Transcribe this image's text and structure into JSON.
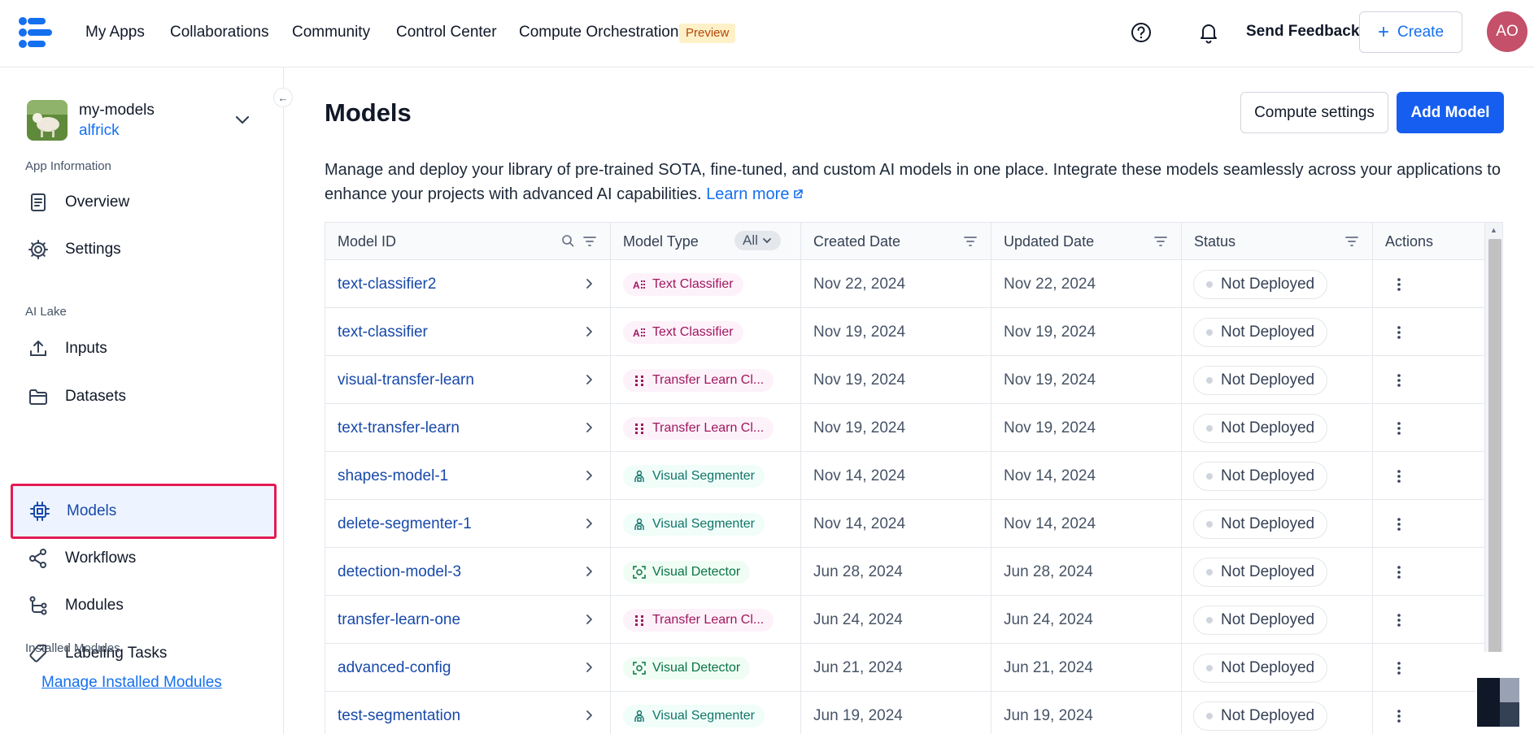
{
  "topnav": {
    "items": [
      "My Apps",
      "Collaborations",
      "Community",
      "Control Center",
      "Compute Orchestration"
    ],
    "preview_badge": "Preview",
    "send_feedback": "Send Feedback",
    "create_label": "Create",
    "avatar_initials": "AO"
  },
  "sidebar": {
    "app_name": "my-models",
    "app_user": "alfrick",
    "section_app_info": "App Information",
    "overview": "Overview",
    "settings": "Settings",
    "section_ai_lake": "AI Lake",
    "inputs": "Inputs",
    "datasets": "Datasets",
    "models": "Models",
    "workflows": "Workflows",
    "modules": "Modules",
    "labeling_tasks": "Labeling Tasks",
    "section_installed": "Installed Modules",
    "manage_installed": "Manage Installed Modules"
  },
  "main": {
    "title": "Models",
    "compute_settings": "Compute settings",
    "add_model": "Add Model",
    "description": "Manage and deploy your library of pre-trained SOTA, fine-tuned, and custom AI models in one place. Integrate these models seamlessly across your applications to enhance your projects with advanced AI capabilities.",
    "learn_more": "Learn more"
  },
  "table": {
    "headers": {
      "model_id": "Model ID",
      "model_type": "Model Type",
      "type_filter": "All",
      "created": "Created Date",
      "updated": "Updated Date",
      "status": "Status",
      "actions": "Actions"
    },
    "rows": [
      {
        "id": "text-classifier2",
        "type": "Text Classifier",
        "kind": "text",
        "created": "Nov 22, 2024",
        "updated": "Nov 22, 2024",
        "status": "Not Deployed"
      },
      {
        "id": "text-classifier",
        "type": "Text Classifier",
        "kind": "text",
        "created": "Nov 19, 2024",
        "updated": "Nov 19, 2024",
        "status": "Not Deployed"
      },
      {
        "id": "visual-transfer-learn",
        "type": "Transfer Learn Cl...",
        "kind": "transfer",
        "created": "Nov 19, 2024",
        "updated": "Nov 19, 2024",
        "status": "Not Deployed"
      },
      {
        "id": "text-transfer-learn",
        "type": "Transfer Learn Cl...",
        "kind": "transfer",
        "created": "Nov 19, 2024",
        "updated": "Nov 19, 2024",
        "status": "Not Deployed"
      },
      {
        "id": "shapes-model-1",
        "type": "Visual Segmenter",
        "kind": "segmenter",
        "created": "Nov 14, 2024",
        "updated": "Nov 14, 2024",
        "status": "Not Deployed"
      },
      {
        "id": "delete-segmenter-1",
        "type": "Visual Segmenter",
        "kind": "segmenter",
        "created": "Nov 14, 2024",
        "updated": "Nov 14, 2024",
        "status": "Not Deployed"
      },
      {
        "id": "detection-model-3",
        "type": "Visual Detector",
        "kind": "detector",
        "created": "Jun 28, 2024",
        "updated": "Jun 28, 2024",
        "status": "Not Deployed"
      },
      {
        "id": "transfer-learn-one",
        "type": "Transfer Learn Cl...",
        "kind": "transfer",
        "created": "Jun 24, 2024",
        "updated": "Jun 24, 2024",
        "status": "Not Deployed"
      },
      {
        "id": "advanced-config",
        "type": "Visual Detector",
        "kind": "detector",
        "created": "Jun 21, 2024",
        "updated": "Jun 21, 2024",
        "status": "Not Deployed"
      },
      {
        "id": "test-segmentation",
        "type": "Visual Segmenter",
        "kind": "segmenter",
        "created": "Jun 19, 2024",
        "updated": "Jun 19, 2024",
        "status": "Not Deployed"
      }
    ]
  },
  "colors": {
    "accent": "#155eef",
    "link": "#1570ef",
    "active_outline": "#e31b54",
    "avatar": "#c4506a"
  }
}
